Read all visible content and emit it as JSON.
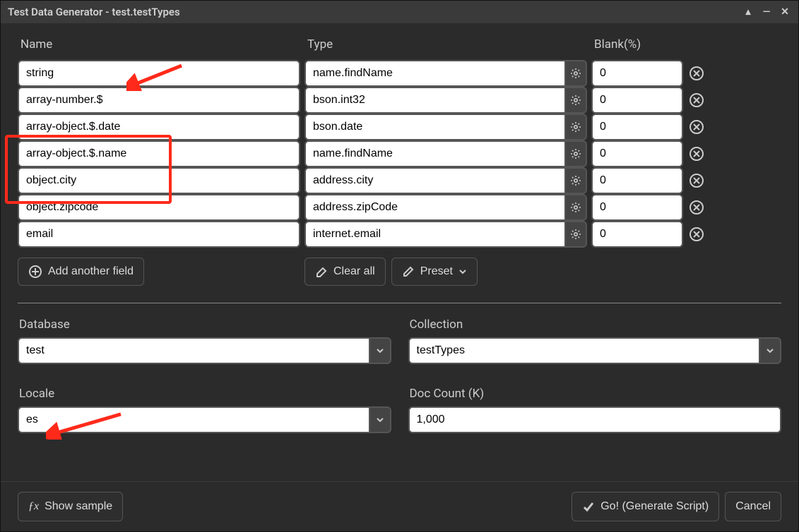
{
  "window": {
    "title": "Test Data Generator - test.testTypes"
  },
  "headers": {
    "name": "Name",
    "type": "Type",
    "blank": "Blank(%)"
  },
  "rows": [
    {
      "name": "string",
      "type": "name.findName",
      "blank": "0"
    },
    {
      "name": "array-number.$",
      "type": "bson.int32",
      "blank": "0"
    },
    {
      "name": "array-object.$.date",
      "type": "bson.date",
      "blank": "0"
    },
    {
      "name": "array-object.$.name",
      "type": "name.findName",
      "blank": "0"
    },
    {
      "name": "object.city",
      "type": "address.city",
      "blank": "0"
    },
    {
      "name": "object.zipcode",
      "type": "address.zipCode",
      "blank": "0"
    },
    {
      "name": "email",
      "type": "internet.email",
      "blank": "0"
    }
  ],
  "actions": {
    "add_field": "Add another field",
    "clear_all": "Clear all",
    "preset": "Preset"
  },
  "lower": {
    "database_label": "Database",
    "database_value": "test",
    "collection_label": "Collection",
    "collection_value": "testTypes",
    "locale_label": "Locale",
    "locale_value": "es",
    "doccount_label": "Doc Count (K)",
    "doccount_value": "1,000"
  },
  "footer": {
    "show_sample": "Show sample",
    "go": "Go! (Generate Script)",
    "cancel": "Cancel"
  }
}
